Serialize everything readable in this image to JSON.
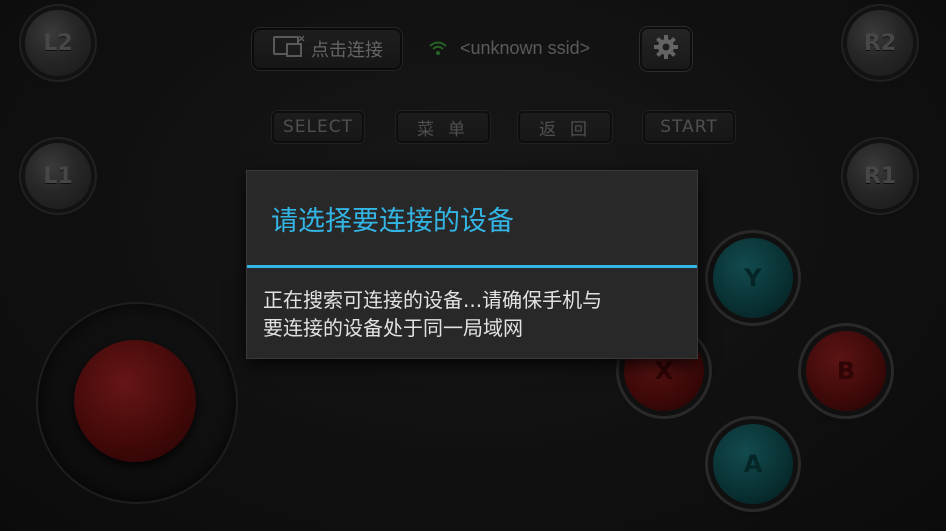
{
  "shoulder": {
    "l2": "L2",
    "l1": "L1",
    "r2": "R2",
    "r1": "R1"
  },
  "topbar": {
    "connect_label": "点击连接",
    "ssid": "<unknown ssid>"
  },
  "buttons": {
    "select": "SELECT",
    "menu": "菜单",
    "back": "返回",
    "start": "START"
  },
  "action_buttons": {
    "y": "Y",
    "x": "X",
    "b": "B",
    "a": "A"
  },
  "dialog": {
    "title": "请选择要连接的设备",
    "message_line1": "正在搜索可连接的设备...请确保手机与",
    "message_line2": "要连接的设备处于同一局域网"
  },
  "icons": {
    "connect": "cast-screen-icon",
    "wifi": "wifi-icon",
    "settings": "gear-icon"
  },
  "colors": {
    "accent": "#33b5e5",
    "wifi": "#3a9a3a",
    "teal_button": "#0e4a4e",
    "red_button": "#6a0f0f"
  }
}
